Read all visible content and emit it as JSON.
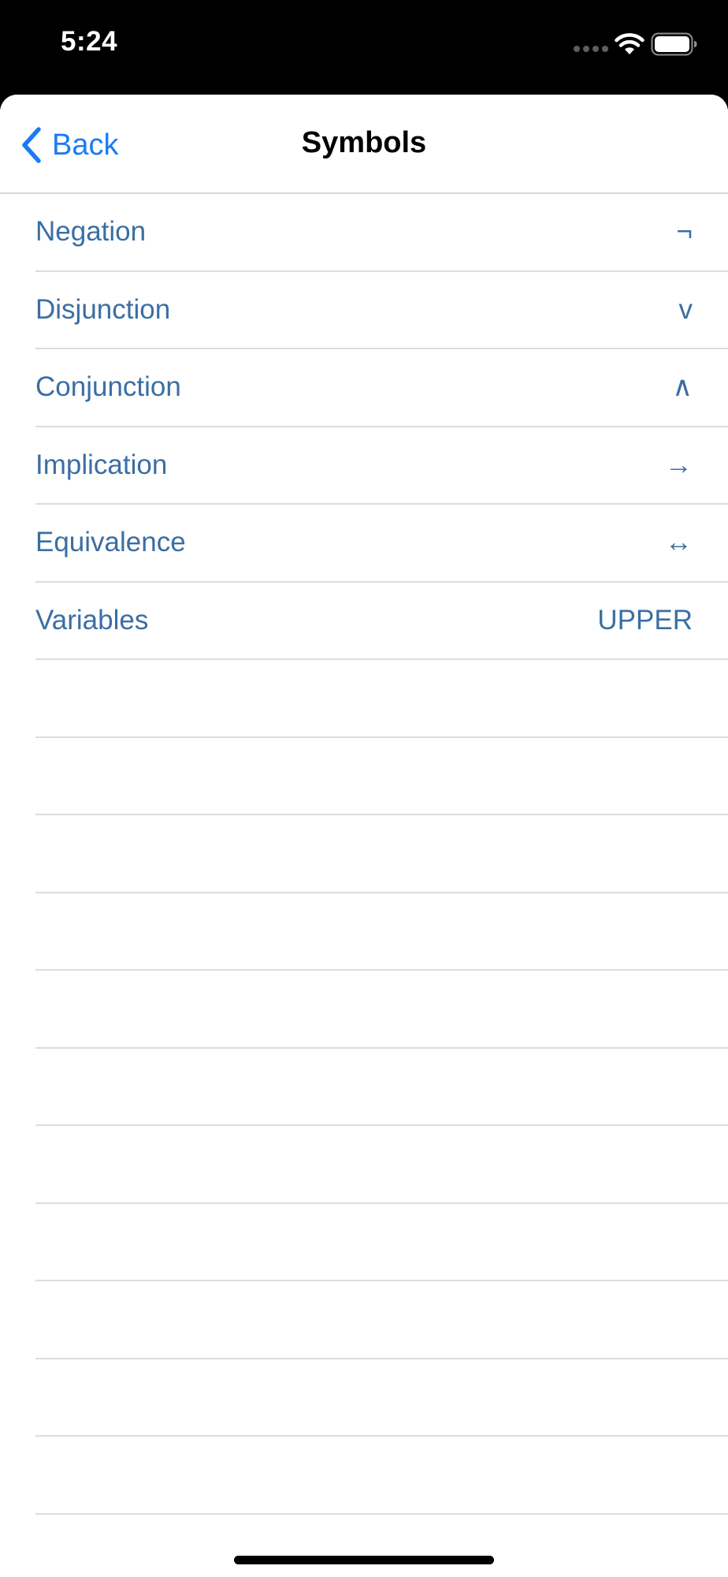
{
  "status_bar": {
    "time": "5:24"
  },
  "nav": {
    "back_label": "Back",
    "title": "Symbols"
  },
  "symbols": [
    {
      "label": "Negation",
      "value": "¬"
    },
    {
      "label": "Disjunction",
      "value": "v"
    },
    {
      "label": "Conjunction",
      "value": "∧"
    },
    {
      "label": "Implication",
      "value": "→"
    },
    {
      "label": "Equivalence",
      "value": "↔"
    },
    {
      "label": "Variables",
      "value": "UPPER"
    }
  ],
  "colors": {
    "accent": "#1a7cf5",
    "row_text": "#3b6ea3",
    "separator": "#dcdce0",
    "status_bar_bg": "#000000"
  },
  "icons": {
    "back": "chevron-left-icon",
    "wifi": "wifi-icon",
    "battery": "battery-icon",
    "signal": "signal-dots-icon"
  }
}
